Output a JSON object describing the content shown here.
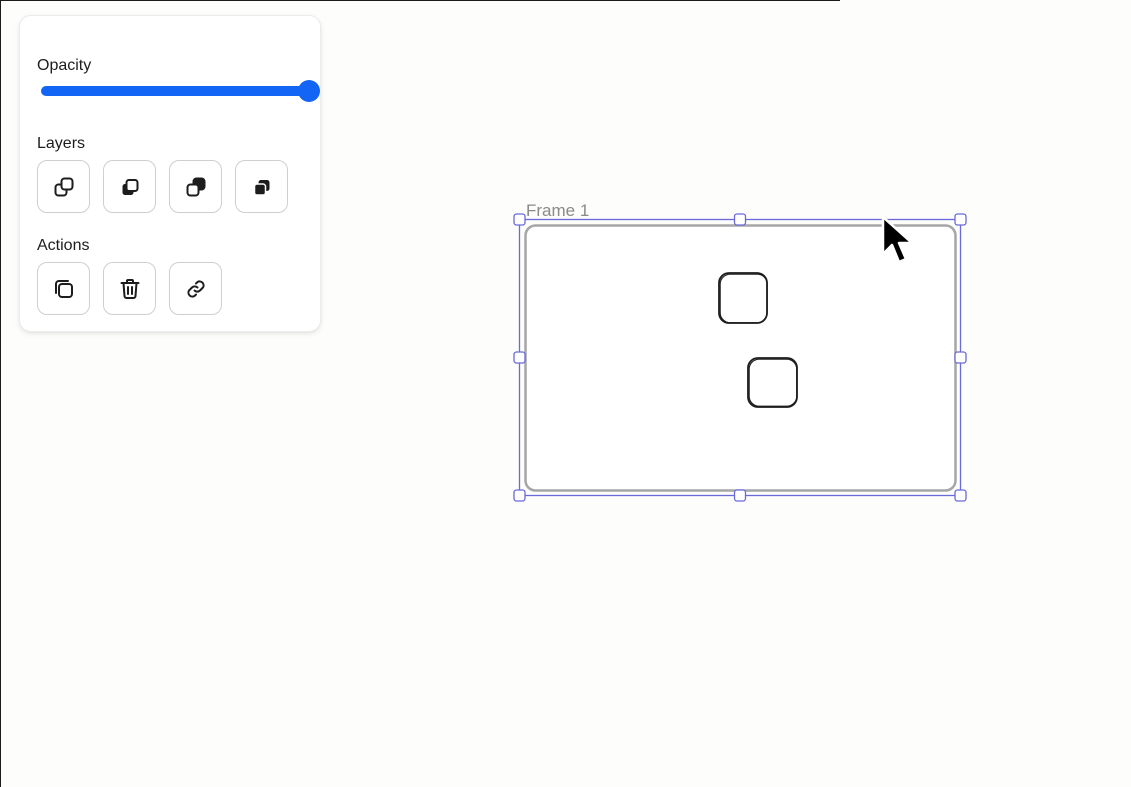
{
  "panel": {
    "opacity": {
      "label": "Opacity",
      "value": 1.0
    },
    "layers": {
      "label": "Layers",
      "buttons": [
        {
          "icon": "bring-forward-icon"
        },
        {
          "icon": "bring-to-front-icon"
        },
        {
          "icon": "send-backward-icon"
        },
        {
          "icon": "send-to-back-icon"
        }
      ]
    },
    "actions": {
      "label": "Actions",
      "buttons": [
        {
          "icon": "duplicate-icon"
        },
        {
          "icon": "trash-icon"
        },
        {
          "icon": "link-icon"
        }
      ]
    }
  },
  "canvas": {
    "frame": {
      "label": "Frame 1"
    },
    "selection_color": "#6a6ad8"
  },
  "colors": {
    "accent": "#1366f5",
    "frame_stroke": "#a6a6a6",
    "shape_stroke": "#1d1d1d"
  }
}
